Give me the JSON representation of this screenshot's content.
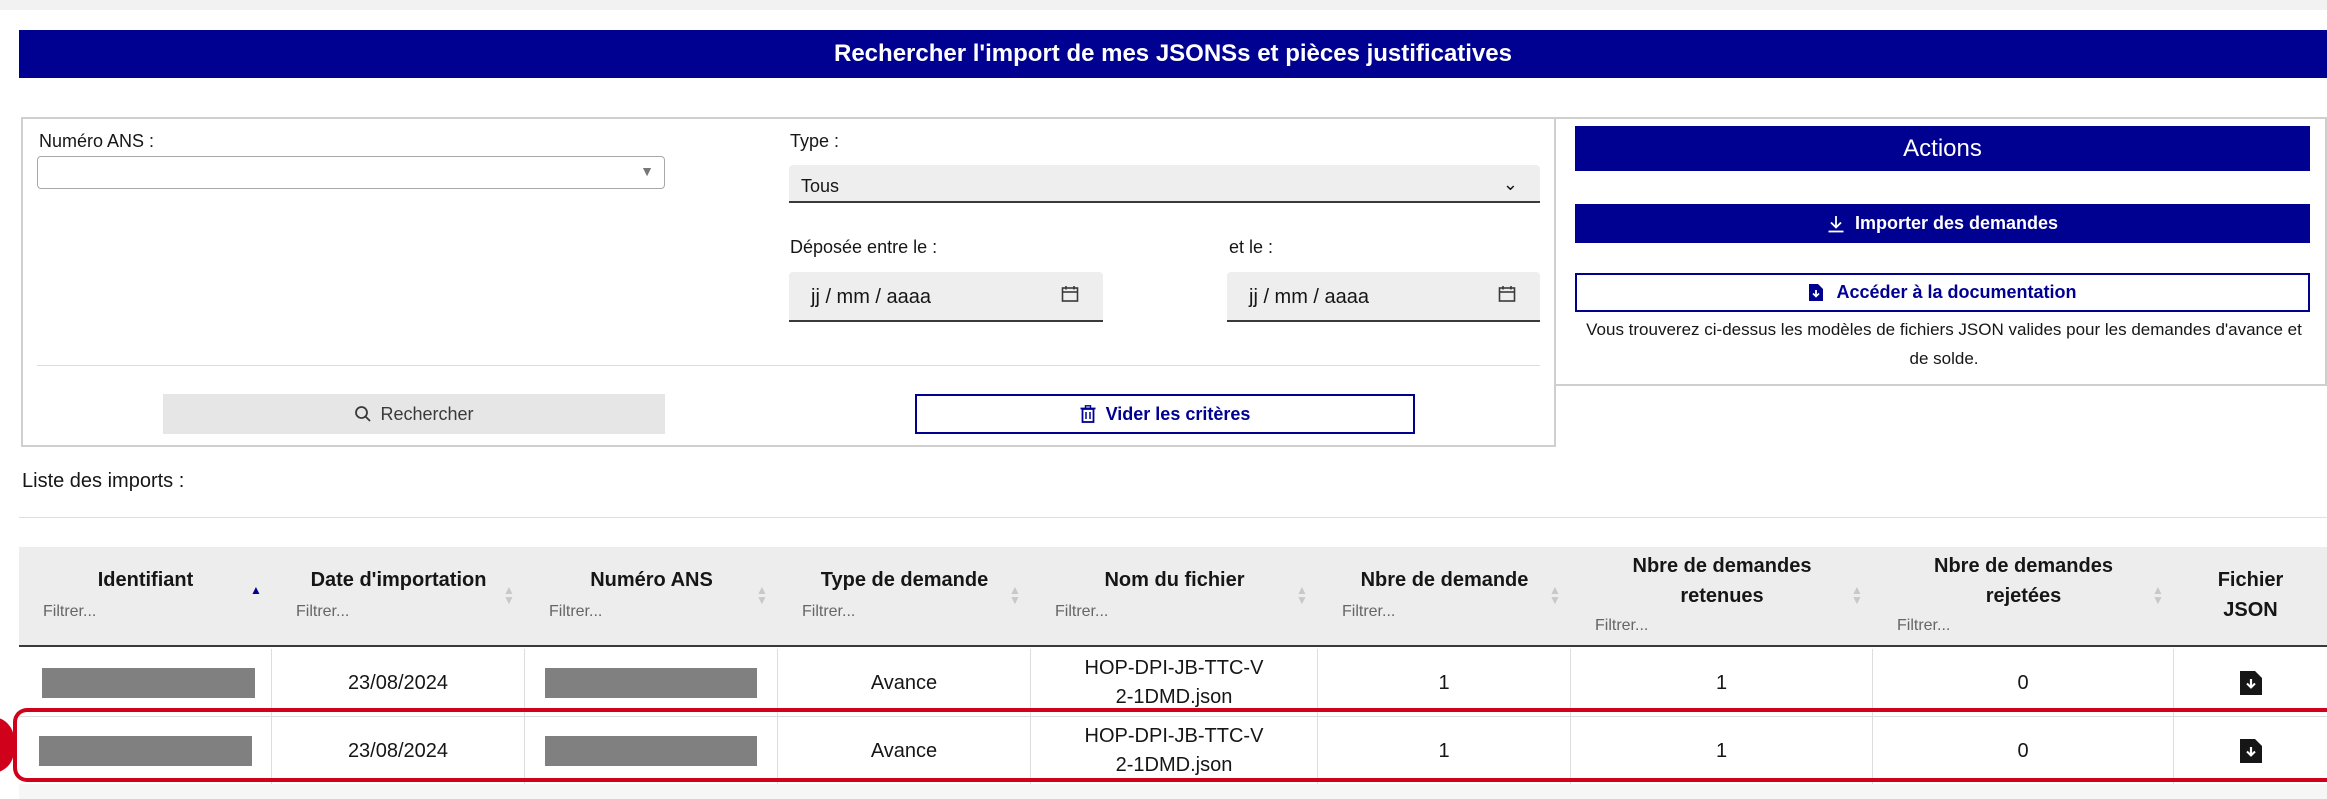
{
  "banner": {
    "title": "Rechercher l'import de mes JSONSs et pièces justificatives"
  },
  "search": {
    "numero_ans_label": "Numéro ANS :",
    "type_label": "Type :",
    "type_value": "Tous",
    "date_from_label": "Déposée entre le :",
    "date_to_label": "et le :",
    "date_placeholder": "jj / mm / aaaa",
    "search_button": "Rechercher",
    "clear_button": "Vider les critères"
  },
  "actions": {
    "header": "Actions",
    "import_button": "Importer des demandes",
    "doc_button": "Accéder à la documentation",
    "note": "Vous trouverez ci-dessus les modèles de fichiers JSON valides pour les demandes d'avance et de solde."
  },
  "list": {
    "title": "Liste des imports :",
    "filter_placeholder": "Filtrer...",
    "columns": [
      "Identifiant",
      "Date d'importation",
      "Numéro ANS",
      "Type de demande",
      "Nom du fichier",
      "Nbre de demande",
      "Nbre de demandes retenues",
      "Nbre de demandes rejetées",
      "Fichier JSON"
    ],
    "sorted_column": "Identifiant",
    "sort_direction": "ascending",
    "rows": [
      {
        "date": "23/08/2024",
        "type": "Avance",
        "file": "HOP-DPI-JB-TTC-V2-1DMD.json",
        "nbre": "1",
        "retenues": "1",
        "rejetees": "0",
        "highlighted": false
      },
      {
        "date": "23/08/2024",
        "type": "Avance",
        "file": "HOP-DPI-JB-TTC-V2-1DMD.json",
        "nbre": "1",
        "retenues": "1",
        "rejetees": "0",
        "highlighted": true
      }
    ]
  },
  "colors": {
    "primary": "#000091",
    "highlight": "#d0021b"
  }
}
